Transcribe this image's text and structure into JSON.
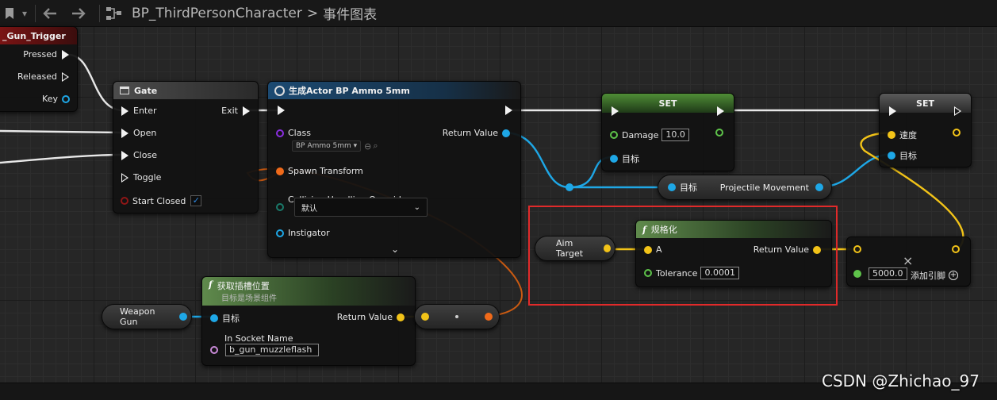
{
  "toolbar": {
    "breadcrumb_blueprint": "BP_ThirdPersonCharacter",
    "breadcrumb_separator": ">",
    "breadcrumb_graph": "事件图表",
    "back_icon": "arrow-left-icon",
    "forward_icon": "arrow-right-icon"
  },
  "nodes": {
    "gun_trigger": {
      "title": "_Gun_Trigger",
      "pins": {
        "pressed": "Pressed",
        "released": "Released",
        "key": "Key"
      }
    },
    "gate": {
      "title": "Gate",
      "pins": {
        "enter": "Enter",
        "exit": "Exit",
        "open": "Open",
        "close": "Close",
        "toggle": "Toggle",
        "start_closed": "Start Closed"
      },
      "start_closed_checked": true
    },
    "spawn": {
      "title": "生成Actor BP Ammo 5mm",
      "pins": {
        "class": "Class",
        "class_value": "BP Ammo 5mm",
        "return_value": "Return Value",
        "spawn_transform": "Spawn Transform",
        "collision": "Collision Handling Override",
        "collision_value": "默认",
        "instigator": "Instigator"
      }
    },
    "set_damage": {
      "title": "SET",
      "pins": {
        "damage": "Damage",
        "damage_value": "10.0",
        "target": "目标"
      }
    },
    "set_speed": {
      "title": "SET",
      "pins": {
        "speed": "速度",
        "target": "目标"
      }
    },
    "projectile_movement": {
      "pins": {
        "target": "目标",
        "output": "Projectile Movement"
      }
    },
    "normalize": {
      "title": "规格化",
      "pins": {
        "a": "A",
        "return_value": "Return Value",
        "tolerance": "Tolerance",
        "tolerance_value": "0.0001"
      }
    },
    "multiply": {
      "value": "5000.0",
      "add_pin": "添加引脚"
    },
    "aim_target": {
      "label": "Aim Target"
    },
    "get_socket": {
      "title": "获取插槽位置",
      "subtitle": "目标是场景组件",
      "pins": {
        "target": "目标",
        "return_value": "Return Value",
        "socket_name": "In Socket Name",
        "socket_value": "b_gun_muzzleflash"
      }
    },
    "weapon_gun": {
      "label": "Weapon Gun"
    }
  },
  "watermark": "CSDN @Zhichao_97",
  "colors": {
    "exec": "#f2f2f2",
    "object": "#1ea7e6",
    "vector": "#f2c318",
    "float": "#5ec34a",
    "struct": "#f06a1a",
    "class": "#8a2ee0",
    "bool": "#8f1616",
    "highlight": "#e12a2a"
  }
}
